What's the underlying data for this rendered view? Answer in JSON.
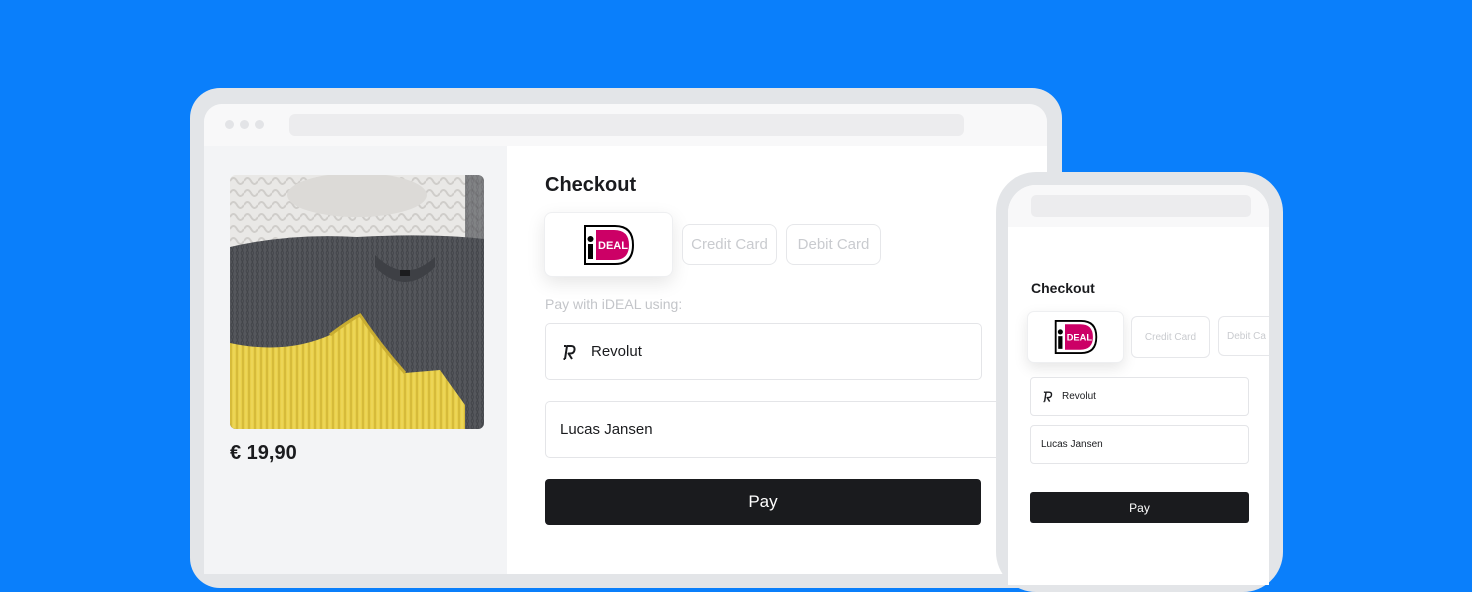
{
  "colors": {
    "background": "#0a7ffb",
    "ideal_magenta": "#cc0066",
    "pay_button": "#1a1b1e"
  },
  "desktop": {
    "product": {
      "image": "knit-sweaters-photo",
      "price": "€ 19,90"
    },
    "checkout": {
      "title": "Checkout",
      "methods": {
        "ideal_logo_text": "iDEAL",
        "credit_card": "Credit Card",
        "debit_card": "Debit Card"
      },
      "pay_with_label": "Pay with iDEAL using:",
      "bank_field": {
        "icon": "revolut-icon",
        "value": "Revolut"
      },
      "name_field": {
        "value": "Lucas Jansen"
      },
      "pay_button": "Pay"
    }
  },
  "mobile": {
    "checkout": {
      "title": "Checkout",
      "methods": {
        "ideal_logo_text": "iDEAL",
        "credit_card": "Credit Card",
        "debit_card": "Debit Ca"
      },
      "bank_field": {
        "icon": "revolut-icon",
        "value": "Revolut"
      },
      "name_field": {
        "value": "Lucas Jansen"
      },
      "pay_button": "Pay"
    }
  }
}
